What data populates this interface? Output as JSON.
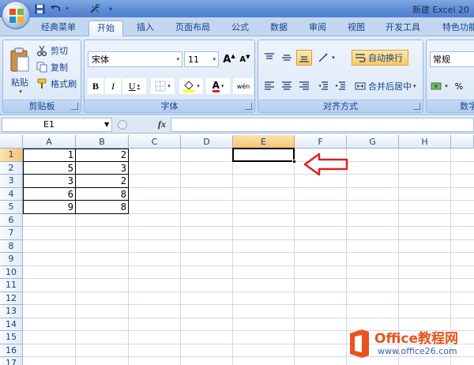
{
  "title_bar": {
    "title": "新建 Excel 20"
  },
  "quick_access": {
    "icons": [
      "save-icon",
      "undo-icon",
      "redo-icon",
      "customize-icon"
    ]
  },
  "tabs": [
    {
      "label": "经典菜单",
      "active": false
    },
    {
      "label": "开始",
      "active": true
    },
    {
      "label": "插入",
      "active": false
    },
    {
      "label": "页面布局",
      "active": false
    },
    {
      "label": "公式",
      "active": false
    },
    {
      "label": "数据",
      "active": false
    },
    {
      "label": "审阅",
      "active": false
    },
    {
      "label": "视图",
      "active": false
    },
    {
      "label": "开发工具",
      "active": false
    },
    {
      "label": "特色功能",
      "active": false
    }
  ],
  "ribbon": {
    "clipboard": {
      "paste_label": "粘贴",
      "cut_label": "剪切",
      "copy_label": "复制",
      "format_painter_label": "格式刷",
      "group_label": "剪贴板"
    },
    "font": {
      "font_name": "宋体",
      "font_size": "11",
      "grow_label": "A",
      "shrink_label": "A",
      "bold_label": "B",
      "italic_label": "I",
      "underline_label": "U",
      "color_letter": "A",
      "phonetic_label": "wén",
      "group_label": "字体"
    },
    "alignment": {
      "wrap_text_label": "自动换行",
      "merge_center_label": "合并后居中",
      "group_label": "对齐方式"
    },
    "number": {
      "format_value": "常规",
      "group_label": "数字",
      "percent_label": "%"
    }
  },
  "formula_bar": {
    "name_box": "E1",
    "fx_label": "fx",
    "formula": ""
  },
  "sheet": {
    "columns": [
      "A",
      "B",
      "C",
      "D",
      "E",
      "F",
      "G",
      "H"
    ],
    "rows": [
      "1",
      "2",
      "3",
      "4",
      "5",
      "6",
      "7",
      "8",
      "9",
      "10",
      "11",
      "12",
      "13",
      "14",
      "15",
      "16",
      "17"
    ],
    "active_cell": "E1",
    "data": [
      {
        "row": "1",
        "A": "1",
        "B": "2"
      },
      {
        "row": "2",
        "A": "5",
        "B": "3"
      },
      {
        "row": "3",
        "A": "3",
        "B": "2"
      },
      {
        "row": "4",
        "A": "6",
        "B": "8"
      },
      {
        "row": "5",
        "A": "9",
        "B": "8"
      }
    ]
  },
  "annotation": {
    "arrow_color": "#e02020"
  },
  "watermark": {
    "text": "Office教程网",
    "url": "www.office26.com"
  }
}
